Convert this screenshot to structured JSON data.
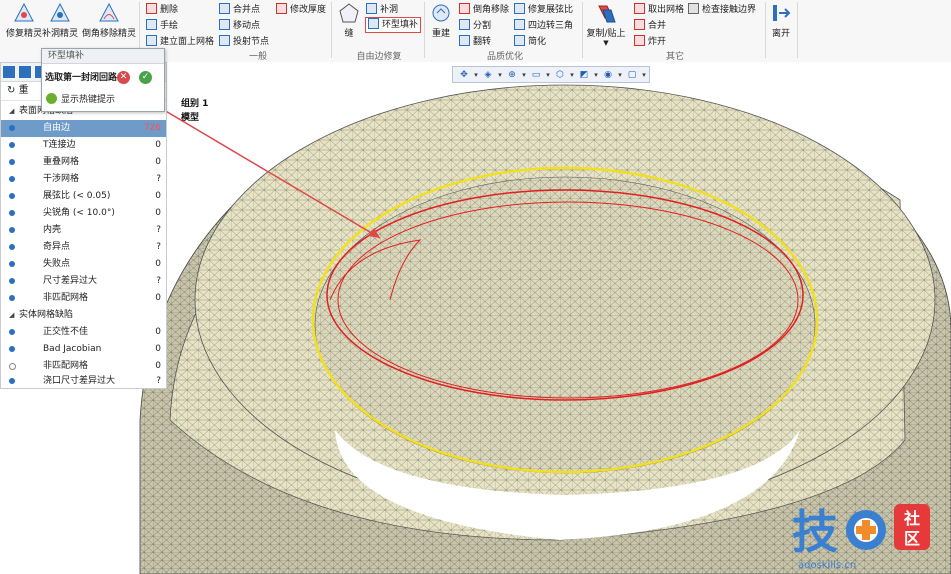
{
  "ribbon": {
    "groups": [
      {
        "label": ""
      },
      {
        "label": "一般"
      },
      {
        "label": "自由边修复"
      },
      {
        "label": "品质优化"
      },
      {
        "label": "其它"
      }
    ],
    "wizards": [
      "修复精灵",
      "补洞精灵",
      "倒角移除精灵"
    ],
    "general": [
      "删除",
      "手绘",
      "建立面上网格",
      "合并点",
      "移动点",
      "投射节点",
      "修改厚度"
    ],
    "free_edge": [
      "缝",
      "补洞",
      "环型填补"
    ],
    "quality": [
      "重建",
      "倒角移除",
      "分割",
      "翻转",
      "修复展弦比",
      "四边转三角",
      "简化"
    ],
    "other": [
      "复制/贴上",
      "取出网格",
      "合并",
      "炸开",
      "检查接触边界"
    ],
    "leave": "离开"
  },
  "popup": {
    "title": "环型填补",
    "prompt": "选取第一封闭回路",
    "hint": "显示热键提示"
  },
  "panel": {
    "toolbar_text": "重",
    "group1": "表面网格缺陷",
    "group2": "实体网格缺陷",
    "rows": [
      {
        "label": "自由边",
        "count": "726"
      },
      {
        "label": "T连接边",
        "count": "0"
      },
      {
        "label": "重叠网格",
        "count": "0"
      },
      {
        "label": "干涉网格",
        "count": "?"
      },
      {
        "label": "展弦比 (< 0.05)",
        "count": "0"
      },
      {
        "label": "尖锐角 (< 10.0°)",
        "count": "0"
      },
      {
        "label": "内壳",
        "count": "?"
      },
      {
        "label": "奇异点",
        "count": "?"
      },
      {
        "label": "失败点",
        "count": "0"
      },
      {
        "label": "尺寸差异过大",
        "count": "?"
      },
      {
        "label": "非匹配网格",
        "count": "0"
      }
    ],
    "solid_rows": [
      {
        "label": "正交性不佳",
        "count": "0"
      },
      {
        "label": "Bad Jacobian",
        "count": "0"
      },
      {
        "label": "非匹配网格",
        "count": "0"
      },
      {
        "label": "浇口尺寸差异过大",
        "count": "?"
      }
    ]
  },
  "viewport": {
    "group_label": "组别 1",
    "model_label": "模型"
  },
  "watermark": {
    "char1": "技",
    "char2": "社",
    "char3": "区",
    "url": "adoskills.cn"
  },
  "colors": {
    "mesh_fill": "#e7e3c4",
    "mesh_line": "#6f6e62",
    "selected_loop": "#f0e020",
    "loop": "#e02020",
    "arrow": "#e04848",
    "selected_row": "#6e9bc8"
  }
}
